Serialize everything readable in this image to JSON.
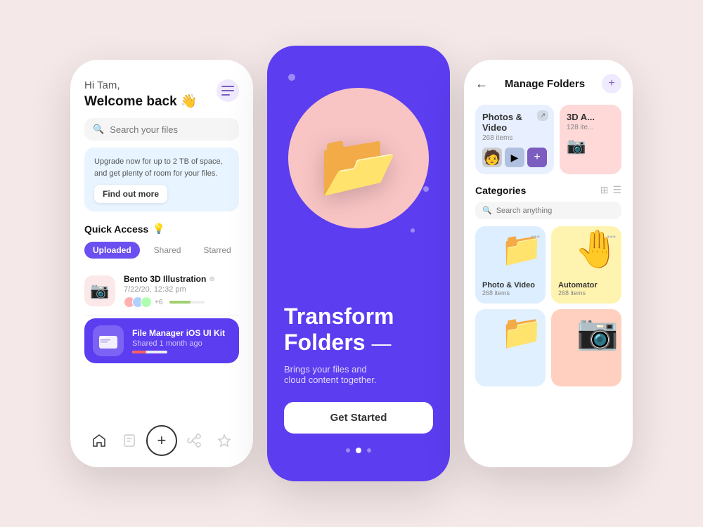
{
  "background": "#f5e8e8",
  "screen1": {
    "greeting": "Hi Tam,",
    "welcome": "Welcome back 👋",
    "menu_icon": "☰",
    "search_placeholder": "Search your files",
    "upgrade_text": "Upgrade now for up to 2 TB of space, and get plenty of room for your files.",
    "upgrade_btn": "Find out more",
    "quick_access_label": "Quick Access",
    "quick_access_emoji": "💡",
    "tabs": [
      "Uploaded",
      "Shared",
      "Starred"
    ],
    "active_tab": "Uploaded",
    "files": [
      {
        "name": "Bento 3D Illustration",
        "date": "7/22/20, 12:32 pm",
        "icon_type": "pink",
        "icon_emoji": "📷",
        "avatar_count": "+6",
        "progress": 60,
        "progress_color": "#a0d070",
        "highlighted": false
      },
      {
        "name": "File Manager iOS UI Kit",
        "date": "Shared 1 month ago",
        "icon_type": "purple",
        "icon_emoji": "📁",
        "progress": 40,
        "progress_color": "#ff6060",
        "highlighted": true
      }
    ],
    "nav": [
      "🏠",
      "📁",
      "+",
      "🔄",
      "⭐"
    ]
  },
  "screen2": {
    "title": "Transform\nFolders",
    "subtitle": "Brings your files and\ncloud content together.",
    "cta_button": "Get Started",
    "dots_count": 3,
    "active_dot": 1
  },
  "screen3": {
    "header_title": "Manage Folders",
    "back_icon": "←",
    "plus_icon": "+",
    "folders": [
      {
        "title": "Photos & Video",
        "count": "268 items",
        "color": "blue"
      },
      {
        "title": "3D A...",
        "count": "128 ite...",
        "color": "pink"
      }
    ],
    "categories_label": "Categories",
    "search_placeholder": "Search anything",
    "categories": [
      {
        "name": "Photo & Video",
        "count": "268 items",
        "emoji": "📁",
        "color": "light-blue"
      },
      {
        "name": "Automator",
        "count": "268 items",
        "emoji": "✋",
        "color": "yellow"
      },
      {
        "name": "",
        "count": "",
        "emoji": "📦",
        "color": "light-blue2"
      },
      {
        "name": "",
        "count": "",
        "emoji": "📷",
        "color": "salmon"
      }
    ]
  }
}
